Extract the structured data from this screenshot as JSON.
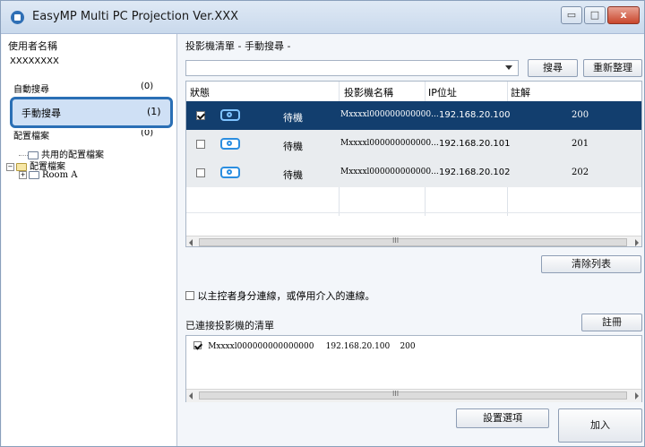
{
  "window": {
    "title": "EasyMP Multi PC Projection Ver.XXX",
    "controls": {
      "minimize": "▭",
      "maximize": "□",
      "close": "x"
    }
  },
  "left": {
    "user_label": "使用者名稱",
    "user_value": "XXXXXXXX",
    "nav": [
      {
        "label": "自動搜尋",
        "count": "(0)"
      },
      {
        "label": "手動搜尋",
        "count": "(1)"
      },
      {
        "label": "配置檔案",
        "count": "(0)"
      }
    ],
    "tree": {
      "shared": "共用的配置檔案",
      "profile": "配置檔案",
      "room": "Room A"
    }
  },
  "right": {
    "header": "投影機清單 - 手動搜尋 -",
    "search_button": "搜尋",
    "refresh_button": "重新整理",
    "columns": [
      "狀態",
      "投影機名稱",
      "IP位址",
      "註解"
    ],
    "rows": [
      {
        "checked": true,
        "status": "待機",
        "name": "Mxxxxl000000000000...",
        "ip": "192.168.20.100",
        "note": "200"
      },
      {
        "checked": false,
        "status": "待機",
        "name": "Mxxxxl000000000000...",
        "ip": "192.168.20.101",
        "note": "201"
      },
      {
        "checked": false,
        "status": "待機",
        "name": "Mxxxxl000000000000...",
        "ip": "192.168.20.102",
        "note": "202"
      }
    ],
    "scroll_grip": "III",
    "clear_button": "清除列表",
    "host_checkbox": "以主控者身分連線，或停用介入的連線。",
    "connected_label": "已連接投影機的清單",
    "register_button": "註冊",
    "connected_item": {
      "name": "Mxxxxl000000000000000",
      "ip": "192.168.20.100",
      "note": "200"
    },
    "settings_button": "設置選項",
    "join_button": "加入"
  }
}
